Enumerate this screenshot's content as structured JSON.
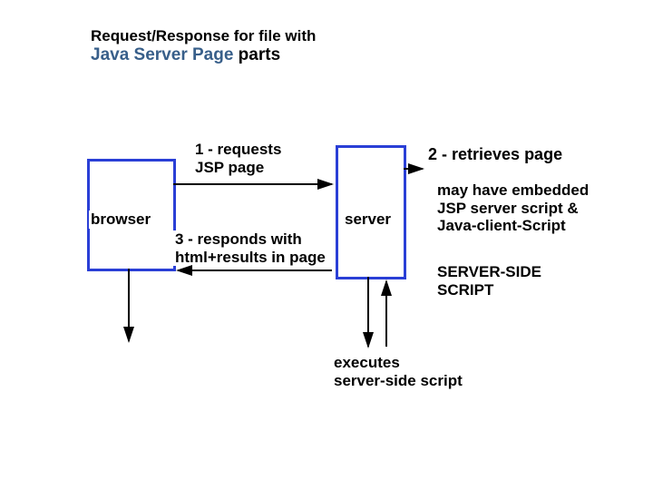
{
  "header": {
    "line1": "Request/Response for file with",
    "jsp": "Java Server Page",
    "parts": " parts"
  },
  "browser_label": "browser",
  "server_label": "server",
  "step1": {
    "l1": "1 - requests",
    "l2": "JSP page"
  },
  "step3": {
    "l1": "3 - responds with",
    "l2": "html+results in page"
  },
  "step2": "2 - retrieves page",
  "note": {
    "l1": "may have embedded",
    "l2": "JSP server script &",
    "l3": "Java-client-Script"
  },
  "server_side_script": {
    "l1": "SERVER-SIDE",
    "l2": "SCRIPT"
  },
  "executes": {
    "l1": "executes",
    "l2": "server-side script"
  }
}
